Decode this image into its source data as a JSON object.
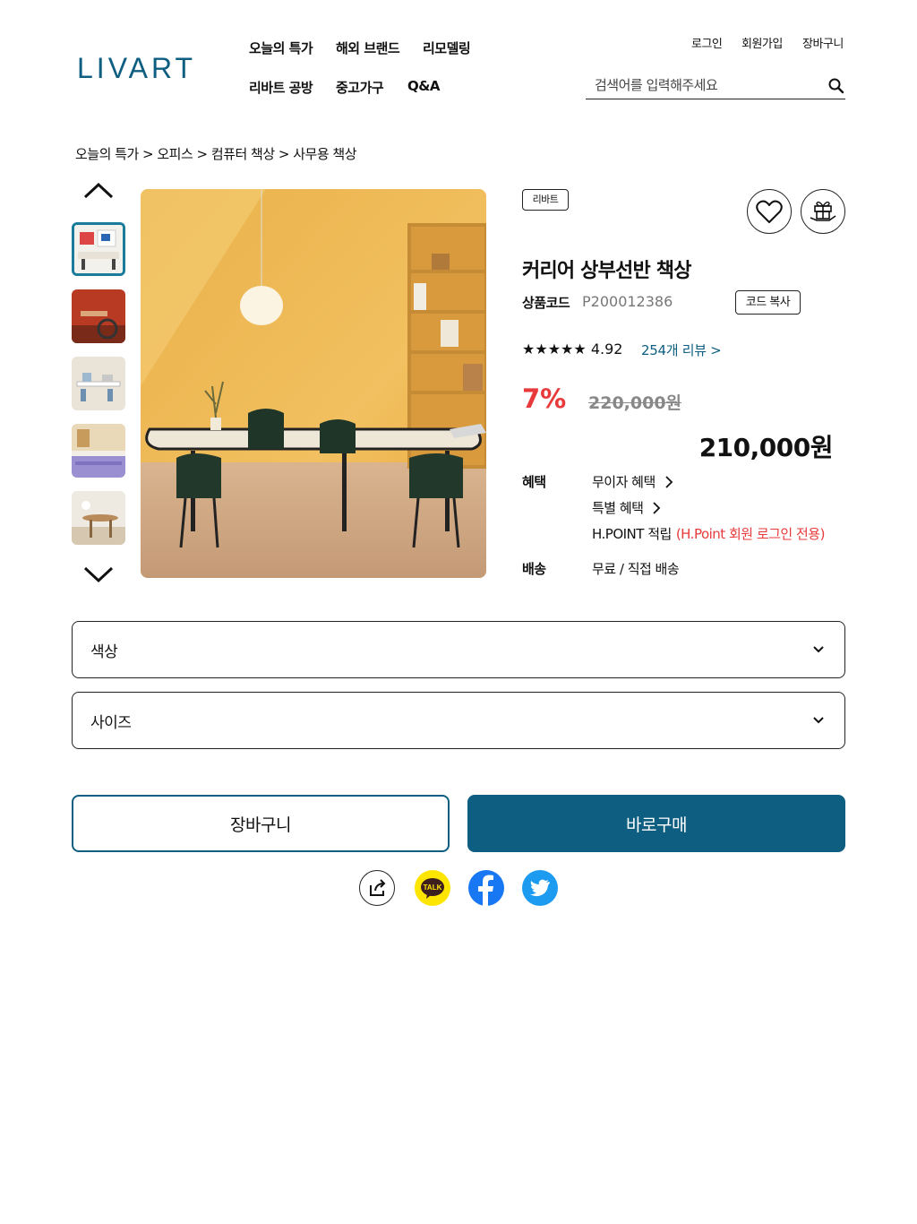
{
  "header": {
    "logo": "LIVART",
    "nav": [
      "오늘의 특가",
      "해외 브랜드",
      "리모델링",
      "리바트 공방",
      "중고가구",
      "Q&A"
    ],
    "util": [
      "로그인",
      "회원가입",
      "장바구니"
    ],
    "search_placeholder": "검색어를 입력해주세요"
  },
  "breadcrumb": "오늘의 특가 > 오피스  > 컴퓨터 책상 > 사무용 책상",
  "product": {
    "brand": "리바트",
    "title": "커리어 상부선반 책상",
    "code_label": "상품코드",
    "code": "P200012386",
    "copy_label": "코드 복사",
    "stars": "★★★★★",
    "rating": "4.92",
    "reviews": "254개 리뷰 >",
    "discount": "7%",
    "original_price": "220,000원",
    "price": "210,000원",
    "benefit_label": "혜택",
    "benefits": [
      "무이자 혜택",
      "특별 혜택"
    ],
    "hpoint": "H.POINT 적립",
    "hpoint_note": "(H.Point 회원 로그인 전용)",
    "delivery_label": "배송",
    "delivery": "무료 / 직접 배송"
  },
  "options": {
    "color_label": "색상",
    "size_label": "사이즈"
  },
  "actions": {
    "cart": "장바구니",
    "buy": "바로구매"
  },
  "colors": {
    "accent": "#0d5e80",
    "sale": "#e83a3a",
    "kakao": "#fee500",
    "facebook": "#1877f2",
    "twitter": "#1d9bf0"
  }
}
